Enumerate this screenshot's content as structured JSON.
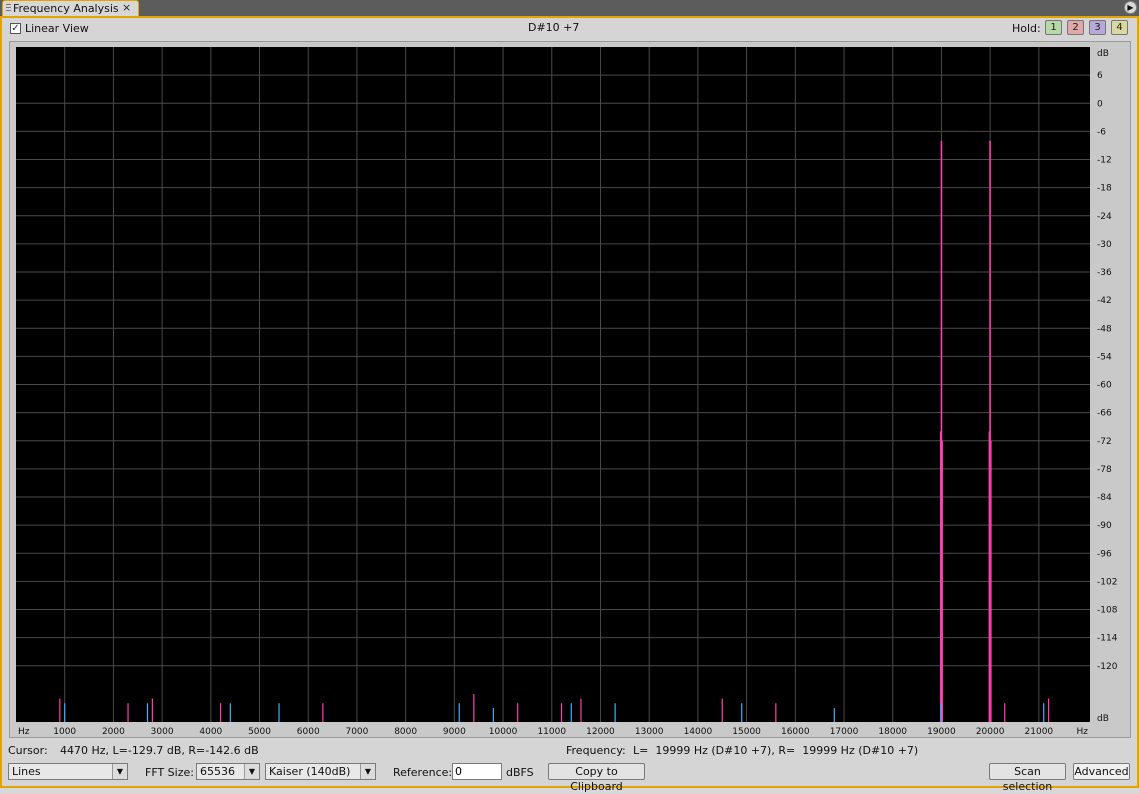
{
  "panel": {
    "title": "Frequency Analysis",
    "close_glyph": "×",
    "menu_icon": "panel-menu-icon"
  },
  "toolbar": {
    "linear_view_label": "Linear View",
    "linear_view_checked": true,
    "note_display": "D#10 +7",
    "hold_label": "Hold:",
    "hold_buttons": [
      {
        "label": "1",
        "color": "#b8d8a8"
      },
      {
        "label": "2",
        "color": "#e0a8a8"
      },
      {
        "label": "3",
        "color": "#b8a8d8"
      },
      {
        "label": "4",
        "color": "#d8d8a0"
      }
    ]
  },
  "status": {
    "cursor_label": "Cursor:",
    "cursor_value": "4470 Hz, L=-129.7 dB, R=-142.6 dB",
    "frequency_label": "Frequency:",
    "frequency_value": "L=  19999 Hz (D#10 +7), R=  19999 Hz (D#10 +7)"
  },
  "controls": {
    "plot_style": "Lines",
    "fft_size_label": "FFT Size:",
    "fft_size": "65536",
    "window": "Kaiser (140dB)",
    "reference_label": "Reference:",
    "reference_value": "0",
    "reference_unit": "dBFS",
    "copy_label": "Copy to Clipboard",
    "scan_label": "Scan selection",
    "advanced_label": "Advanced"
  },
  "chart_data": {
    "type": "line",
    "background": "#000000",
    "grid": true,
    "x_unit": "Hz",
    "y_unit": "dB",
    "xlim": [
      0,
      22050
    ],
    "ylim": [
      -132,
      12
    ],
    "x_ticks": [
      1000,
      2000,
      3000,
      4000,
      5000,
      6000,
      7000,
      8000,
      9000,
      10000,
      11000,
      12000,
      13000,
      14000,
      15000,
      16000,
      17000,
      18000,
      19000,
      20000,
      21000
    ],
    "y_ticks": [
      6,
      0,
      -6,
      -12,
      -18,
      -24,
      -30,
      -36,
      -42,
      -48,
      -54,
      -60,
      -66,
      -72,
      -78,
      -84,
      -90,
      -96,
      -102,
      -108,
      -114,
      -120
    ],
    "series": [
      {
        "color": "#ff3fb0",
        "peaks": [
          [
            19000,
            -8
          ],
          [
            19999,
            -8
          ]
        ],
        "noise": [
          [
            900,
            -127
          ],
          [
            2300,
            -128
          ],
          [
            2800,
            -127
          ],
          [
            4200,
            -128
          ],
          [
            6300,
            -128
          ],
          [
            9400,
            -126
          ],
          [
            10300,
            -128
          ],
          [
            11200,
            -128
          ],
          [
            11600,
            -127
          ],
          [
            14500,
            -127
          ],
          [
            15600,
            -128
          ],
          [
            20300,
            -128
          ],
          [
            21200,
            -127
          ]
        ]
      },
      {
        "color": "#3fb0ff",
        "peaks": [],
        "noise": [
          [
            1000,
            -128
          ],
          [
            2700,
            -128
          ],
          [
            4400,
            -128
          ],
          [
            5400,
            -128
          ],
          [
            9100,
            -128
          ],
          [
            9800,
            -129
          ],
          [
            11400,
            -128
          ],
          [
            12300,
            -128
          ],
          [
            14900,
            -128
          ],
          [
            16800,
            -129
          ],
          [
            19000,
            -128
          ],
          [
            21100,
            -128
          ]
        ]
      }
    ]
  }
}
